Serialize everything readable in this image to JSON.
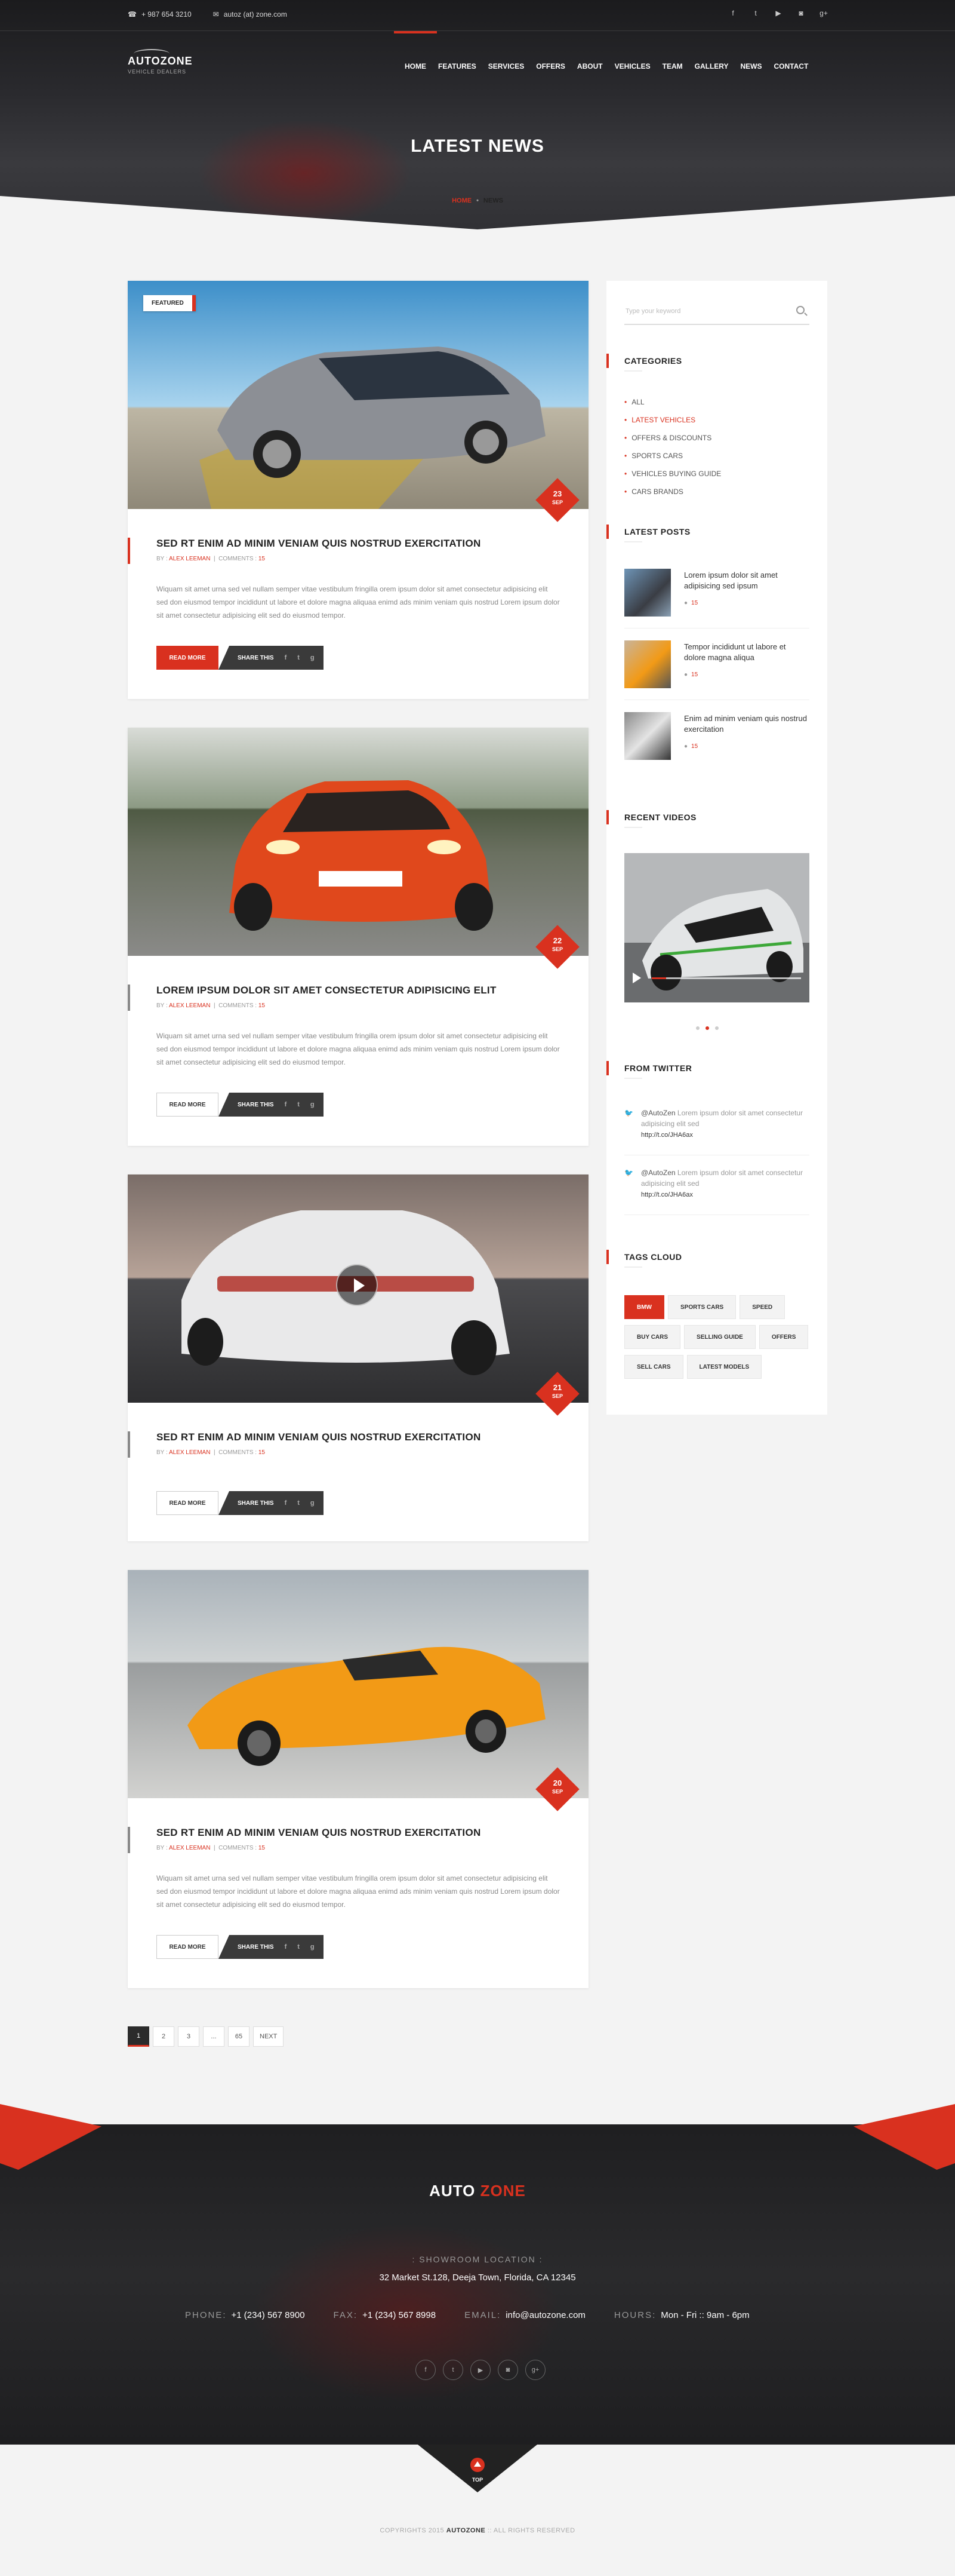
{
  "topbar": {
    "phone": "+ 987 654 3210",
    "email": "autoz (at) zone.com",
    "social_icons": [
      "facebook-icon",
      "twitter-icon",
      "youtube-icon",
      "instagram-icon",
      "google-plus-icon"
    ]
  },
  "brand": {
    "name": "AUTOZONE",
    "tagline": "VEHICLE DEALERS"
  },
  "menu": [
    {
      "label": "HOME",
      "active": true
    },
    {
      "label": "FEATURES"
    },
    {
      "label": "SERVICES"
    },
    {
      "label": "OFFERS"
    },
    {
      "label": "ABOUT"
    },
    {
      "label": "VEHICLES"
    },
    {
      "label": "TEAM"
    },
    {
      "label": "GALLERY"
    },
    {
      "label": "NEWS"
    },
    {
      "label": "CONTACT"
    }
  ],
  "page_title": "LATEST NEWS",
  "breadcrumb": {
    "home": "HOME",
    "current": "NEWS"
  },
  "posts": [
    {
      "badge": "FEATURED",
      "day": "23",
      "month": "SEP",
      "title": "SED RT ENIM AD MINIM VENIAM QUIS NOSTRUD EXERCITATION",
      "by": "BY :",
      "author": "ALEX LEEMAN",
      "comments_label": "COMMENTS :",
      "comments": "15",
      "excerpt": "Wiquam sit amet urna sed vel nullam semper vitae vestibulum fringilla orem ipsum dolor sit amet consectetur adipisicing elit sed don eiusmod tempor incididunt ut labore et dolore magna aliquaa enimd ads minim veniam quis nostrud Lorem ipsum dolor sit amet consectetur adipisicing elit sed do eiusmod tempor.",
      "read_more": "READ MORE",
      "share": "SHARE THIS"
    },
    {
      "day": "22",
      "month": "SEP",
      "title": "LOREM IPSUM DOLOR SIT AMET CONSECTETUR ADIPISICING ELIT",
      "by": "BY :",
      "author": "ALEX LEEMAN",
      "comments_label": "COMMENTS :",
      "comments": "15",
      "excerpt": "Wiquam sit amet urna sed vel nullam semper vitae vestibulum fringilla orem ipsum dolor sit amet consectetur adipisicing elit sed don eiusmod tempor incididunt ut labore et dolore magna aliquaa enimd ads minim veniam quis nostrud Lorem ipsum dolor sit amet consectetur adipisicing elit sed do eiusmod tempor.",
      "read_more": "READ MORE",
      "share": "SHARE THIS"
    },
    {
      "day": "21",
      "month": "SEP",
      "title": "SED RT ENIM AD MINIM VENIAM QUIS NOSTRUD EXERCITATION",
      "by": "BY :",
      "author": "ALEX LEEMAN",
      "comments_label": "COMMENTS :",
      "comments": "15",
      "read_more": "READ MORE",
      "share": "SHARE THIS"
    },
    {
      "day": "20",
      "month": "SEP",
      "title": "SED RT ENIM AD MINIM VENIAM QUIS NOSTRUD EXERCITATION",
      "by": "BY :",
      "author": "ALEX LEEMAN",
      "comments_label": "COMMENTS :",
      "comments": "15",
      "excerpt": "Wiquam sit amet urna sed vel nullam semper vitae vestibulum fringilla orem ipsum dolor sit amet consectetur adipisicing elit sed don eiusmod tempor incididunt ut labore et dolore magna aliquaa enimd ads minim veniam quis nostrud Lorem ipsum dolor sit amet consectetur adipisicing elit sed do eiusmod tempor.",
      "read_more": "READ MORE",
      "share": "SHARE THIS"
    }
  ],
  "sidebar": {
    "search_placeholder": "Type your keyword",
    "categories_title": "CATEGORIES",
    "categories": [
      "ALL",
      "LATEST VEHICLES",
      "OFFERS & DISCOUNTS",
      "SPORTS CARS",
      "VEHICLES BUYING GUIDE",
      "CARS BRANDS"
    ],
    "active_category": "LATEST VEHICLES",
    "latest_posts_title": "LATEST POSTS",
    "latest_posts": [
      {
        "text": "Lorem ipsum dolor sit amet adipisicing sed ipsum",
        "comments": "15"
      },
      {
        "text": "Tempor incididunt ut labore et dolore magna aliqua",
        "comments": "15"
      },
      {
        "text": "Enim ad minim veniam quis nostrud exercitation",
        "comments": "15"
      }
    ],
    "recent_videos_title": "RECENT VIDEOS",
    "from_twitter_title": "FROM TWITTER",
    "tweets": [
      {
        "handle": "@AutoZen",
        "text": "Lorem ipsum dolor sit amet consectetur adipisicing elit sed",
        "link": "http://t.co/JHA6ax"
      },
      {
        "handle": "@AutoZen",
        "text": "Lorem ipsum dolor sit amet consectetur adipisicing elit sed",
        "link": "http://t.co/JHA6ax"
      }
    ],
    "tags_title": "TAGS CLOUD",
    "tags": [
      "BMW",
      "SPORTS CARS",
      "SPEED",
      "BUY CARS",
      "SELLING GUIDE",
      "OFFERS",
      "SELL CARS",
      "LATEST MODELS"
    ],
    "active_tag": "BMW"
  },
  "pagination": [
    "1",
    "2",
    "3",
    "...",
    "65",
    "NEXT"
  ],
  "footer": {
    "logo_a": "AUTO",
    "logo_b": " ZONE",
    "location_title": ": SHOWROOM LOCATION :",
    "address": "32 Market St.128, Deeja Town, Florida, CA 12345",
    "phone_label": "PHONE:",
    "phone": "+1 (234) 567 8900",
    "fax_label": "FAX:",
    "fax": "+1 (234) 567 8998",
    "email_label": "EMAIL:",
    "email": "info@autozone.com",
    "hours_label": "HOURS:",
    "hours": "Mon - Fri :: 9am - 6pm",
    "top_label": "TOP",
    "copyright_a": "COPYRIGHTS 2015 ",
    "copyright_b": "AUTOZONE",
    "copyright_c": " :: ALL RIGHTS RESERVED"
  },
  "colors": {
    "accent": "#d9311f",
    "dark": "#222222",
    "bg": "#f3f3f3"
  }
}
